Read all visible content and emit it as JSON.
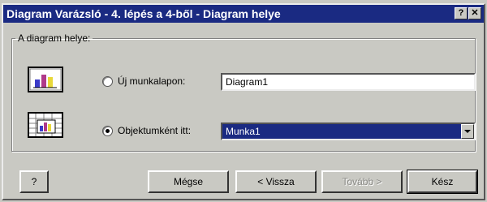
{
  "window": {
    "title": "Diagram Varázsló - 4. lépés a 4-ből - Diagram helye",
    "help_button": "?",
    "close_button": "✕"
  },
  "group": {
    "legend": "A diagram helye:"
  },
  "options": [
    {
      "label": "Új munkalapon:",
      "selected": false,
      "value": "Diagram1"
    },
    {
      "label": "Objektumként itt:",
      "selected": true,
      "value": "Munka1"
    }
  ],
  "buttons": {
    "help": "?",
    "cancel": "Mégse",
    "back": "< Vissza",
    "next": "Tovább >",
    "finish": "Kész"
  },
  "colors": {
    "titlebar": "#1a2a82",
    "face": "#c9c9c3",
    "selection": "#1a2a82"
  }
}
